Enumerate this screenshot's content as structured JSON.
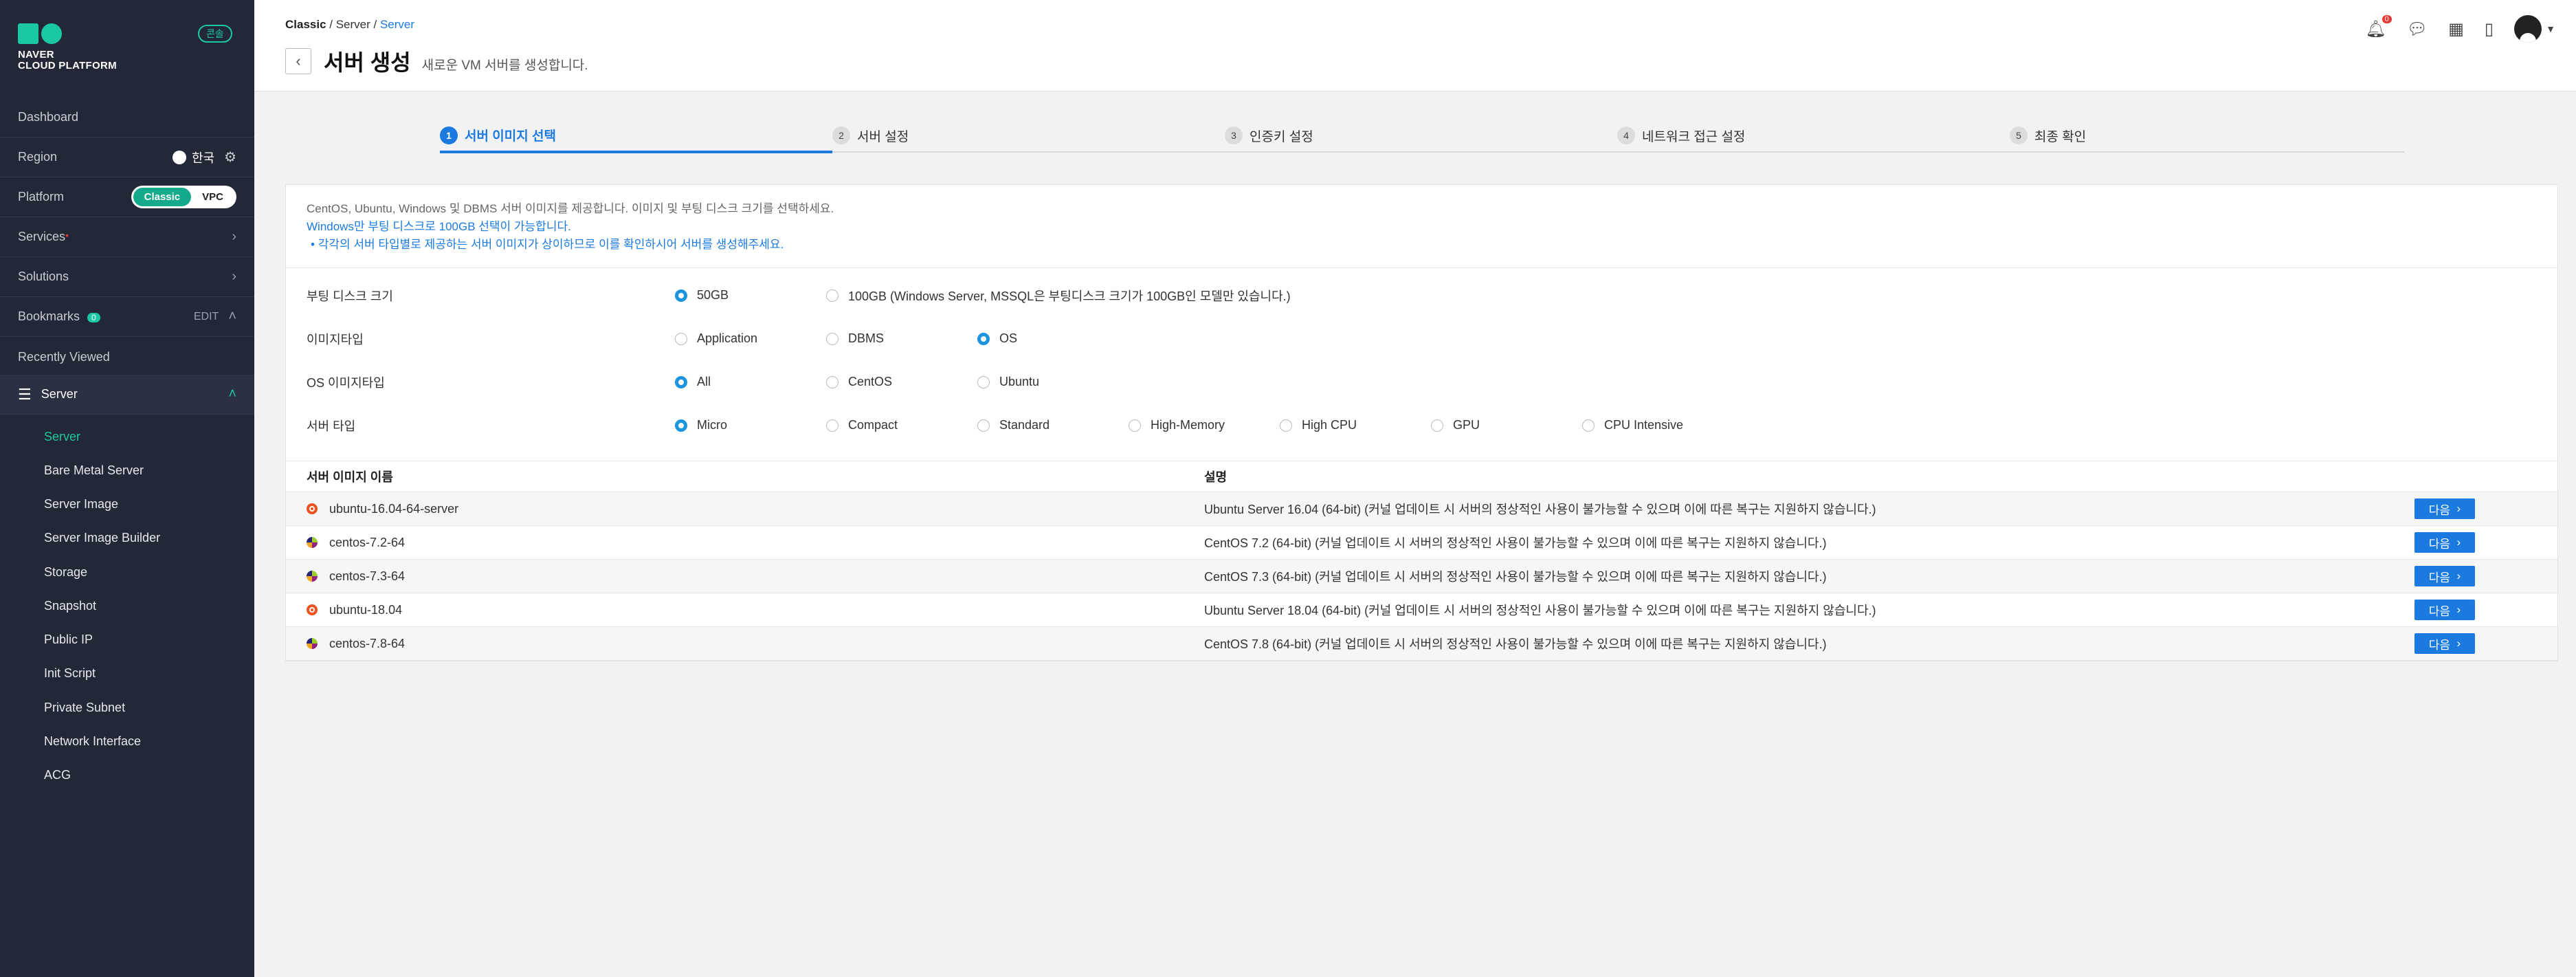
{
  "sidebar": {
    "logo_line1": "NAVER",
    "logo_line2": "CLOUD PLATFORM",
    "env_badge": "콘솔",
    "dashboard": "Dashboard",
    "region_label": "Region",
    "region_value": "한국",
    "platform_label": "Platform",
    "platform_options": [
      "Classic",
      "VPC"
    ],
    "platform_selected": "Classic",
    "services": "Services",
    "solutions": "Solutions",
    "bookmarks": "Bookmarks",
    "bookmarks_count": "0",
    "bookmarks_edit": "EDIT",
    "recently_viewed": "Recently Viewed",
    "server_group": "Server",
    "server_items": [
      "Server",
      "Bare Metal Server",
      "Server Image",
      "Server Image Builder",
      "Storage",
      "Snapshot",
      "Public IP",
      "Init Script",
      "Private Subnet",
      "Network Interface",
      "ACG"
    ],
    "active_item": "Server"
  },
  "header": {
    "breadcrumb": [
      "Classic",
      "Server",
      "Server"
    ],
    "title": "서버 생성",
    "subtitle": "새로운 VM 서버를 생성합니다.",
    "notification_count": "0"
  },
  "steps": [
    {
      "num": "1",
      "label": "서버 이미지 선택"
    },
    {
      "num": "2",
      "label": "서버 설정"
    },
    {
      "num": "3",
      "label": "인증키 설정"
    },
    {
      "num": "4",
      "label": "네트워크 접근 설정"
    },
    {
      "num": "5",
      "label": "최종 확인"
    }
  ],
  "active_step": 1,
  "info": {
    "line1": "CentOS, Ubuntu, Windows 및 DBMS 서버 이미지를 제공합니다. 이미지 및 부팅 디스크 크기를 선택하세요.",
    "line2": "Windows만 부팅 디스크로 100GB 선택이 가능합니다.",
    "line3": "각각의 서버 타입별로 제공하는 서버 이미지가 상이하므로 이를 확인하시어 서버를 생성해주세요."
  },
  "options": {
    "boot_disk": {
      "label": "부팅 디스크 크기",
      "choices": [
        "50GB",
        "100GB (Windows Server, MSSQL은 부팅디스크 크기가 100GB인 모델만 있습니다.)"
      ],
      "selected": "50GB"
    },
    "image_type": {
      "label": "이미지타입",
      "choices": [
        "Application",
        "DBMS",
        "OS"
      ],
      "selected": "OS"
    },
    "os_image_type": {
      "label": "OS 이미지타입",
      "choices": [
        "All",
        "CentOS",
        "Ubuntu"
      ],
      "selected": "All"
    },
    "server_type": {
      "label": "서버 타입",
      "choices": [
        "Micro",
        "Compact",
        "Standard",
        "High-Memory",
        "High CPU",
        "GPU",
        "CPU Intensive"
      ],
      "selected": "Micro"
    }
  },
  "table": {
    "headers": [
      "서버 이미지 이름",
      "설명"
    ],
    "next_label": "다음",
    "rows": [
      {
        "icon": "ubuntu-icon",
        "name": "ubuntu-16.04-64-server",
        "desc": "Ubuntu Server 16.04 (64-bit) (커널 업데이트 시 서버의 정상적인 사용이 불가능할 수 있으며 이에 따른 복구는 지원하지 않습니다.)"
      },
      {
        "icon": "centos-icon",
        "name": "centos-7.2-64",
        "desc": "CentOS 7.2 (64-bit) (커널 업데이트 시 서버의 정상적인 사용이 불가능할 수 있으며 이에 따른 복구는 지원하지 않습니다.)"
      },
      {
        "icon": "centos-icon",
        "name": "centos-7.3-64",
        "desc": "CentOS 7.3 (64-bit) (커널 업데이트 시 서버의 정상적인 사용이 불가능할 수 있으며 이에 따른 복구는 지원하지 않습니다.)"
      },
      {
        "icon": "ubuntu-icon",
        "name": "ubuntu-18.04",
        "desc": "Ubuntu Server 18.04 (64-bit) (커널 업데이트 시 서버의 정상적인 사용이 불가능할 수 있으며 이에 따른 복구는 지원하지 않습니다.)"
      },
      {
        "icon": "centos-icon",
        "name": "centos-7.8-64",
        "desc": "CentOS 7.8 (64-bit) (커널 업데이트 시 서버의 정상적인 사용이 불가능할 수 있으며 이에 따른 복구는 지원하지 않습니다.)"
      }
    ]
  },
  "colors": {
    "accent": "#1b7ae0",
    "brand": "#1ac9a4",
    "sidebar_bg": "#232837"
  }
}
